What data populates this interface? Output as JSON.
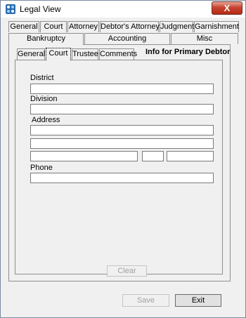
{
  "window": {
    "title": "Legal View",
    "close_symbol": "X"
  },
  "tabs_row1": [
    {
      "label": "General"
    },
    {
      "label": "Court"
    },
    {
      "label": "Attorney"
    },
    {
      "label": "Debtor's Attorney"
    },
    {
      "label": "Judgment"
    },
    {
      "label": "Garnishment"
    }
  ],
  "tabs_row2": [
    {
      "label": "Bankruptcy",
      "active": true
    },
    {
      "label": "Accounting"
    },
    {
      "label": "Misc"
    }
  ],
  "subtabs": [
    {
      "label": "General"
    },
    {
      "label": "Court",
      "active": true
    },
    {
      "label": "Trustee"
    },
    {
      "label": "Comments"
    }
  ],
  "section_title": "Info for Primary Debtor",
  "form": {
    "district_label": "District",
    "district_value": "",
    "division_label": "Division",
    "division_value": "",
    "address_label": "Address",
    "address1_value": "",
    "address2_value": "",
    "city_value": "",
    "state_value": "",
    "zip_value": "",
    "phone_label": "Phone",
    "phone_value": ""
  },
  "buttons": {
    "clear": "Clear",
    "save": "Save",
    "exit": "Exit"
  },
  "icons": {
    "app": "legal-view-app-icon",
    "close": "close-icon"
  }
}
